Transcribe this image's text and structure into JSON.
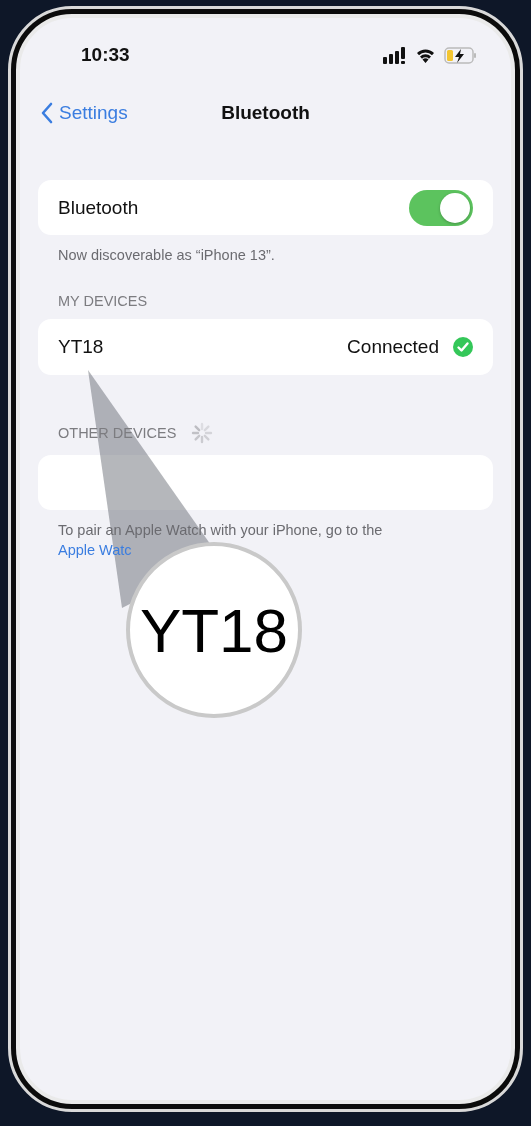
{
  "status_bar": {
    "time": "10:33"
  },
  "nav": {
    "back_label": "Settings",
    "title": "Bluetooth"
  },
  "bluetooth_toggle": {
    "label": "Bluetooth",
    "on": true
  },
  "discoverable_note": "Now discoverable as “iPhone 13”.",
  "my_devices": {
    "header": "MY DEVICES",
    "devices": [
      {
        "name": "YT18",
        "status": "Connected",
        "connected": true
      }
    ]
  },
  "other_devices": {
    "header": "OTHER DEVICES",
    "searching": true
  },
  "footer": {
    "text": "To pair an Apple Watch with your iPhone, go to the",
    "link": "Apple Watc"
  },
  "callout": {
    "text": "YT18"
  }
}
